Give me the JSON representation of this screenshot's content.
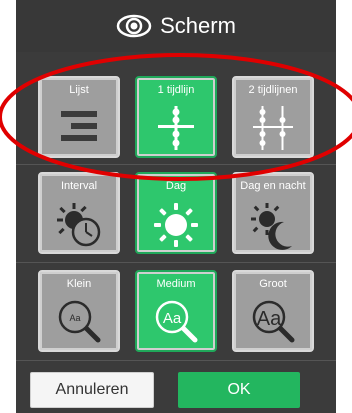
{
  "dialog": {
    "title": "Scherm",
    "title_icon": "eye-icon"
  },
  "groups": [
    {
      "name": "layout",
      "options": [
        {
          "label": "Lijst",
          "icon": "list-icon",
          "selected": false
        },
        {
          "label": "1 tijdlijn",
          "icon": "one-timeline-icon",
          "selected": true
        },
        {
          "label": "2 tijdlijnen",
          "icon": "two-timelines-icon",
          "selected": false
        }
      ]
    },
    {
      "name": "period",
      "options": [
        {
          "label": "Interval",
          "icon": "sun-clock-icon",
          "selected": false
        },
        {
          "label": "Dag",
          "icon": "sun-icon",
          "selected": true
        },
        {
          "label": "Dag en nacht",
          "icon": "sun-moon-icon",
          "selected": false
        }
      ]
    },
    {
      "name": "size",
      "options": [
        {
          "label": "Klein",
          "icon": "magnifier-small-icon",
          "selected": false
        },
        {
          "label": "Medium",
          "icon": "magnifier-medium-icon",
          "selected": true
        },
        {
          "label": "Groot",
          "icon": "magnifier-large-icon",
          "selected": false
        }
      ]
    }
  ],
  "magnifier_text": "Aa",
  "buttons": {
    "cancel": "Annuleren",
    "ok": "OK"
  },
  "colors": {
    "selected": "#2ec76d",
    "unselected": "#9e9e9e",
    "background": "#3b3b3b",
    "annotation": "#e00000"
  }
}
